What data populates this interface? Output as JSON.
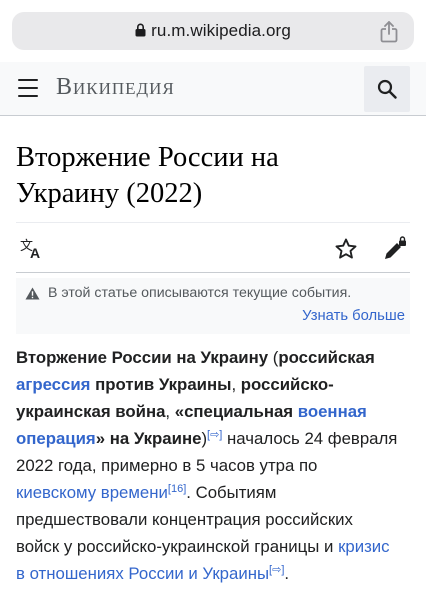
{
  "browser": {
    "url": "ru.m.wikipedia.org"
  },
  "header": {
    "wordmark": "Википедия"
  },
  "article": {
    "title_line1": "Вторжение России на",
    "title_line2": "Украину (2022)"
  },
  "notice": {
    "text": "В этой статье описываются текущие события.",
    "link": "Узнать больше"
  },
  "body": {
    "l1_bold": "Вторжение России на Украину",
    "l1_plain": " (",
    "l1_bold2": "российская",
    "l2_link": "агрессия",
    "l2_bold": " против Украины",
    "l2_plain": ", ",
    "l2_bold2": "российско-",
    "l3_bold": "украинская война",
    "l3_plain": ", ",
    "l3_bold2": "«специальная ",
    "l3_link": "военная",
    "l4_link": "операция",
    "l4_bold": "» на Украине",
    "l4_plain": ")",
    "l4_sup": "[⇨]",
    "l4_plain2": " началось 24 февраля",
    "l5_plain": "2022 года, примерно в 5 часов утра по",
    "l6_link": "киевскому времени",
    "l6_sup": "[16]",
    "l6_plain": ". Событиям",
    "l7_plain": "предшествовали концентрация российских",
    "l8_plain": "войск у российско-украинской границы и ",
    "l8_link": "кризис",
    "l9_link": "в отношениях России и Украины",
    "l9_sup": "[⇨]",
    "l9_plain": "."
  },
  "icons": {
    "lock": "lock-icon",
    "share": "share-icon",
    "menu": "menu-icon",
    "search": "search-icon",
    "language": "language-icon",
    "watch": "star-icon",
    "edit": "pencil-lock-icon",
    "notice": "warning-icon"
  },
  "colors": {
    "link": "#3366cc",
    "text": "#202122",
    "muted": "#54595d"
  }
}
